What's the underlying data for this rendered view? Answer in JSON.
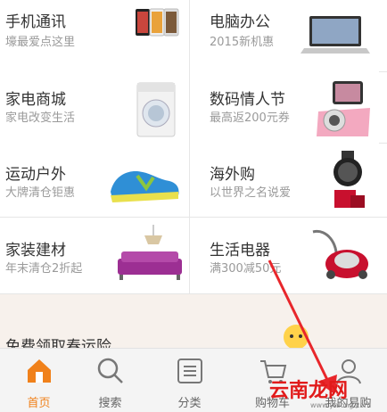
{
  "grid": {
    "items": [
      {
        "title": "手机通讯",
        "subtitle": "壕最爱点这里",
        "image": "smartphones-image"
      },
      {
        "title": "电脑办公",
        "subtitle": "2015新机惠",
        "image": "laptop-image"
      },
      {
        "title": "家电商城",
        "subtitle": "家电改变生活",
        "image": "washing-machine-image"
      },
      {
        "title": "数码情人节",
        "subtitle": "最高返200元券",
        "image": "pink-camera-image"
      },
      {
        "title": "运动户外",
        "subtitle": "大牌清仓钜惠",
        "image": "sneaker-image"
      },
      {
        "title": "海外购",
        "subtitle": "以世界之名说爱",
        "image": "watch-cosmetics-image"
      },
      {
        "title": "家装建材",
        "subtitle": "年末清仓2折起",
        "image": "sofa-chandelier-image"
      },
      {
        "title": "生活电器",
        "subtitle": "满300减50元",
        "image": "vacuum-cleaner-image"
      }
    ]
  },
  "banner": {
    "text": "免费领取春运险"
  },
  "tabbar": {
    "tabs": [
      {
        "label": "首页",
        "icon": "home-icon",
        "active": true
      },
      {
        "label": "搜索",
        "icon": "search-icon",
        "active": false
      },
      {
        "label": "分类",
        "icon": "list-icon",
        "active": false
      },
      {
        "label": "购物车",
        "icon": "cart-icon",
        "active": false
      },
      {
        "label": "我的易购",
        "icon": "user-icon",
        "active": false
      }
    ]
  },
  "watermark": {
    "text": "云南龙网",
    "url": "www.ynlong.com"
  },
  "colors": {
    "accent": "#f0811b",
    "arrow": "#e8262b",
    "divider": "#e6e6e6",
    "subtitle": "#9a9a9a"
  }
}
